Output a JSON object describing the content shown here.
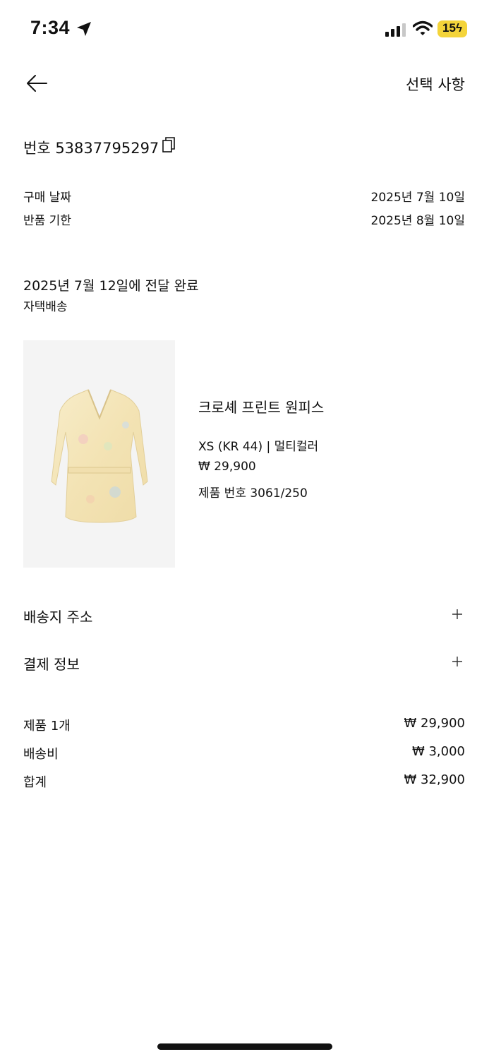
{
  "status_bar": {
    "time": "7:34",
    "battery": "15"
  },
  "header": {
    "options_label": "선택 사항"
  },
  "order": {
    "number": "번호 53837795297",
    "purchase_date_label": "구매 날짜",
    "purchase_date": "2025년 7월 10일",
    "return_deadline_label": "반품 기한",
    "return_deadline": "2025년 8월 10일"
  },
  "delivery": {
    "status": "2025년 7월 12일에 전달 완료",
    "method": "자택배송"
  },
  "product": {
    "name": "크로셰 프린트 원피스",
    "variant": "XS (KR 44) | 멀티컬러",
    "price": "₩ 29,900",
    "product_number": "제품 번호 3061/250"
  },
  "sections": [
    {
      "label": "배송지 주소"
    },
    {
      "label": "결제 정보"
    }
  ],
  "summary": [
    {
      "label": "제품 1개",
      "value": "₩ 29,900"
    },
    {
      "label": "배송비",
      "value": "₩ 3,000"
    },
    {
      "label": "합계",
      "value": "₩ 32,900"
    }
  ],
  "colors": {
    "battery_yellow": "#f4d43a",
    "text": "#111111",
    "image_bg": "#f4f4f4"
  }
}
